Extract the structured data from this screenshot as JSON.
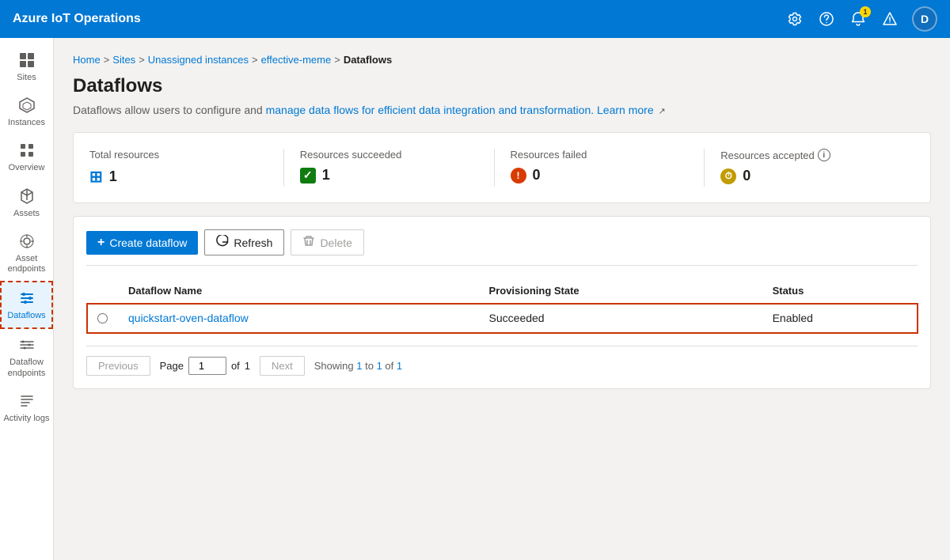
{
  "app": {
    "title": "Azure IoT Operations",
    "avatar_initial": "D"
  },
  "breadcrumb": {
    "items": [
      "Home",
      "Sites",
      "Unassigned instances",
      "effective-meme",
      "Dataflows"
    ]
  },
  "page": {
    "title": "Dataflows",
    "description_static": "Dataflows allow users to configure and ",
    "description_link": "manage data flows for efficient data integration and transformation.",
    "learn_more": "Learn more"
  },
  "stats": {
    "total_resources_label": "Total resources",
    "total_resources_value": "1",
    "resources_succeeded_label": "Resources succeeded",
    "resources_succeeded_value": "1",
    "resources_failed_label": "Resources failed",
    "resources_failed_value": "0",
    "resources_accepted_label": "Resources accepted",
    "resources_accepted_value": "0"
  },
  "toolbar": {
    "create_label": "Create dataflow",
    "refresh_label": "Refresh",
    "delete_label": "Delete"
  },
  "table": {
    "columns": [
      "Dataflow Name",
      "Provisioning State",
      "Status"
    ],
    "rows": [
      {
        "name": "quickstart-oven-dataflow",
        "provisioning_state": "Succeeded",
        "status": "Enabled"
      }
    ]
  },
  "pagination": {
    "previous_label": "Previous",
    "next_label": "Next",
    "page_label": "Page",
    "of_label": "of",
    "total_pages": "1",
    "current_page": "1",
    "showing_text": "Showing 1 to 1 of 1"
  },
  "sidebar": {
    "items": [
      {
        "id": "sites",
        "label": "Sites",
        "icon": "⊞"
      },
      {
        "id": "instances",
        "label": "Instances",
        "icon": "⬡"
      },
      {
        "id": "overview",
        "label": "Overview",
        "icon": "▤"
      },
      {
        "id": "assets",
        "label": "Assets",
        "icon": "◈"
      },
      {
        "id": "asset-endpoints",
        "label": "Asset endpoints",
        "icon": "⬡"
      },
      {
        "id": "dataflows",
        "label": "Dataflows",
        "icon": "⟳",
        "active": true
      },
      {
        "id": "dataflow-endpoints",
        "label": "Dataflow endpoints",
        "icon": "⬡"
      },
      {
        "id": "activity-logs",
        "label": "Activity logs",
        "icon": "≡"
      }
    ]
  }
}
